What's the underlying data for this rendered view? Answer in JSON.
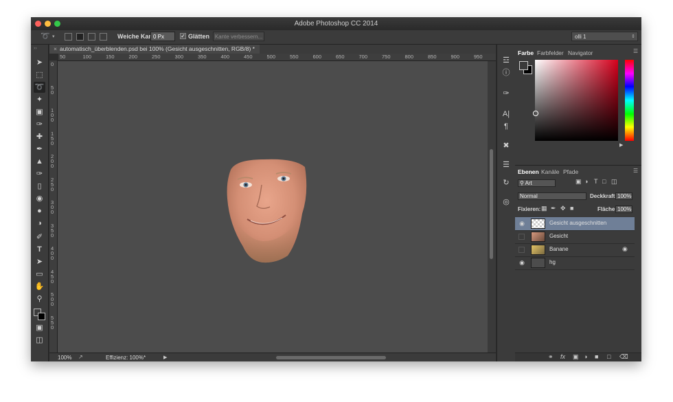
{
  "window": {
    "title": "Adobe Photoshop CC 2014",
    "traffic_colors": [
      "#fc605c",
      "#fdbc40",
      "#34c84a"
    ]
  },
  "options_bar": {
    "feather_label": "Weiche Kante:",
    "feather_value": "0 Px",
    "smooth_label": "Glätten",
    "refine_label": "Kante verbessern...",
    "workspace": "olli 1"
  },
  "document": {
    "tab_title": "automatisch_überblenden.psd bei 100% (Gesicht ausgeschnitten, RGB/8) *",
    "ruler_top_labels": [
      "50",
      "100",
      "150",
      "200",
      "250",
      "300",
      "350",
      "400",
      "450",
      "500",
      "550",
      "600",
      "650",
      "700",
      "750",
      "800",
      "850",
      "900",
      "950"
    ],
    "ruler_left_labels": [
      "0",
      "5\n0",
      "1\n0\n0",
      "1\n5\n0",
      "2\n0\n0",
      "2\n5\n0",
      "3\n0\n0",
      "3\n5\n0",
      "4\n0\n0",
      "4\n5\n0",
      "5\n0\n0",
      "5\n5\n0"
    ],
    "zoom": "100%",
    "status": "Effizienz: 100%*"
  },
  "color_panel": {
    "tabs": [
      "Farbe",
      "Farbfelder",
      "Navigator"
    ],
    "fg_color": "#3a3a3a",
    "bg_color": "#000000"
  },
  "layers_panel": {
    "tabs": [
      "Ebenen",
      "Kanäle",
      "Pfade"
    ],
    "filter_kind": "Art",
    "blend_mode": "Normal",
    "opacity_label": "Deckkraft:",
    "opacity_value": "100%",
    "lock_label": "Fixieren:",
    "fill_label": "Fläche:",
    "fill_value": "100%",
    "layers": [
      {
        "name": "Gesicht ausgeschnitten",
        "visible": true,
        "selected": true
      },
      {
        "name": "Gesicht",
        "visible": false,
        "selected": false
      },
      {
        "name": "Banane",
        "visible": false,
        "selected": false
      },
      {
        "name": "hg",
        "visible": true,
        "selected": false
      }
    ]
  }
}
